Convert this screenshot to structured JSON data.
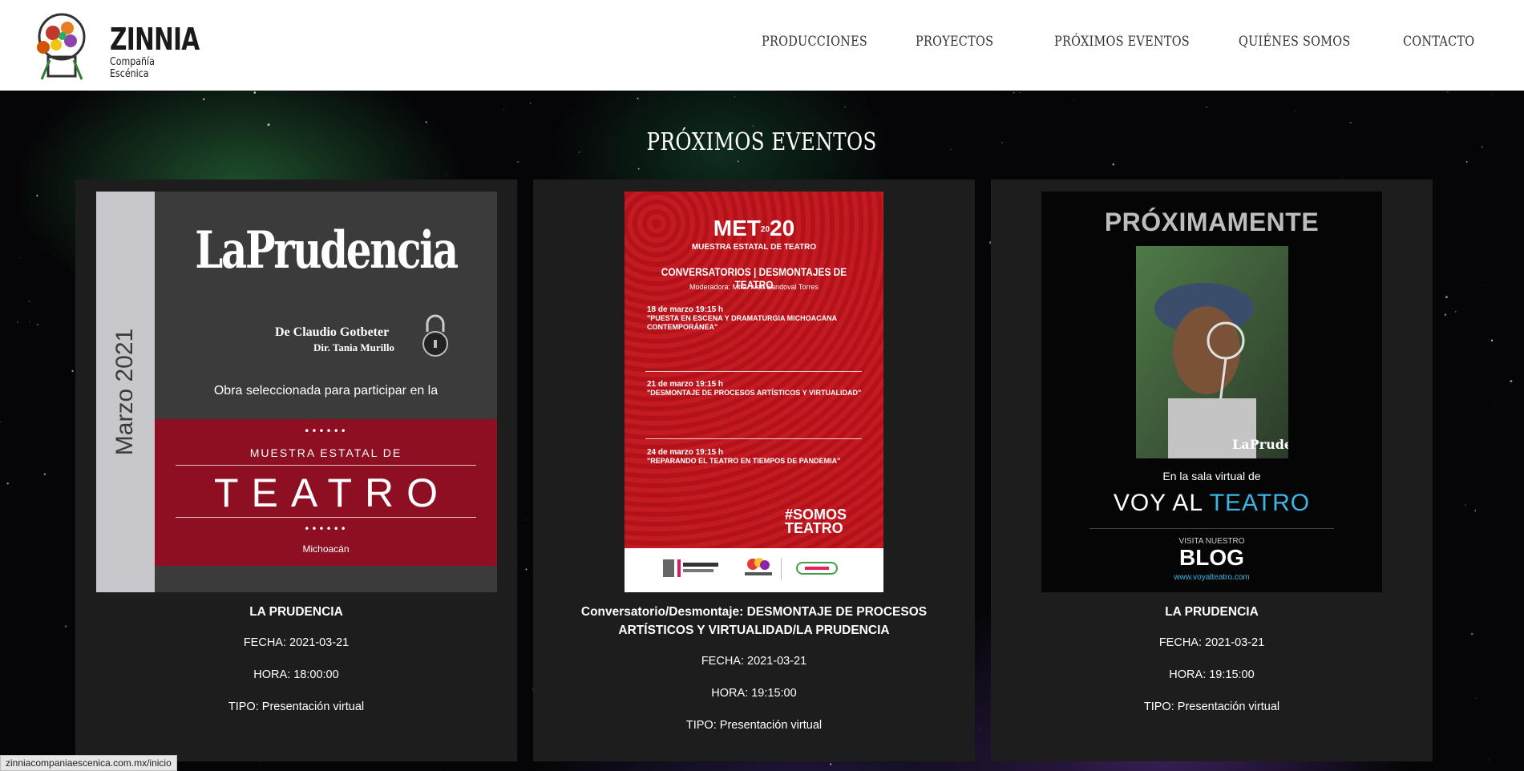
{
  "brand": {
    "name": "ZINNIA",
    "subtitle": "Compañía Escénica"
  },
  "nav": {
    "items": [
      {
        "label": "PRODUCCIONES"
      },
      {
        "label": "PROYECTOS"
      },
      {
        "label": "PRÓXIMOS EVENTOS"
      },
      {
        "label": "QUIÉNES SOMOS"
      },
      {
        "label": "CONTACTO"
      }
    ]
  },
  "section": {
    "title": "PRÓXIMOS EVENTOS"
  },
  "events": [
    {
      "title": "LA PRUDENCIA",
      "fecha": "FECHA: 2021-03-21",
      "hora": "HORA: 18:00:00",
      "tipo": "TIPO: Presentación virtual",
      "poster": {
        "side_text": "Marzo 2021",
        "logo_text": "LaPrudencia",
        "author": "De Claudio Gotbeter",
        "director": "Dir. Tania Murillo",
        "selected": "Obra seleccionada para participar en la",
        "muestra": "MUESTRA ESTATAL DE",
        "teatro": "TEATRO",
        "place": "Michoacán"
      }
    },
    {
      "title_line1": "Conversatorio/Desmontaje: DESMONTAJE DE PROCESOS",
      "title_line2": "ARTÍSTICOS Y VIRTUALIDAD/LA PRUDENCIA",
      "fecha": "FECHA: 2021-03-21",
      "hora": "HORA: 19:15:00",
      "tipo": "TIPO: Presentación virtual",
      "poster": {
        "met": "MET",
        "year": "20",
        "muestra": "MUESTRA ESTATAL DE TEATRO",
        "heading": "CONVERSATORIOS | DESMONTAJES DE TEATRO",
        "moderadora": "Moderadora: Mtra. Ivett Sandoval Torres",
        "d1": "18 de marzo 19:15 h",
        "d1t": "\"PUESTA EN ESCENA Y DRAMATURGIA MICHOACANA CONTEMPORÁNEA\"",
        "d2": "21 de marzo 19:15 h",
        "d2t": "\"DESMONTAJE DE PROCESOS ARTÍSTICOS Y VIRTUALIDAD\"",
        "d3": "24 de marzo 19:15 h",
        "d3t": "\"REPARANDO EL TEATRO EN TIEMPOS DE PANDEMIA\"",
        "hashtag": "#SOMOS TEATRO"
      }
    },
    {
      "title": "LA PRUDENCIA",
      "fecha": "FECHA: 2021-03-21",
      "hora": "HORA: 19:15:00",
      "tipo": "TIPO: Presentación virtual",
      "poster": {
        "headline": "PRÓXIMAMENTE",
        "sala": "En la sala virtual de",
        "voy": "VOY AL",
        "teatro": "TEATRO",
        "visita": "VISITA NUESTRO",
        "blog": "BLOG",
        "url": "www.voyalteatro.com",
        "logo_text": "LaPrudencia"
      }
    }
  ],
  "status_bar": {
    "url": "zinniacompaniaescenica.com.mx/inicio"
  },
  "colors": {
    "card_bg": "#1d1d1d",
    "poster1_red": "#8e0f22",
    "poster2_red": "#c41b22",
    "voy_teatro_blue": "#3ab6e6"
  }
}
